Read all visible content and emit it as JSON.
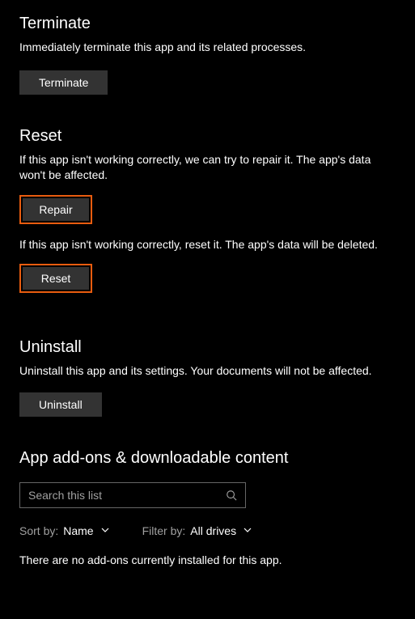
{
  "terminate": {
    "title": "Terminate",
    "desc": "Immediately terminate this app and its related processes.",
    "button": "Terminate"
  },
  "reset": {
    "title": "Reset",
    "repair_desc": "If this app isn't working correctly, we can try to repair it. The app's data won't be affected.",
    "repair_button": "Repair",
    "reset_desc": "If this app isn't working correctly, reset it. The app's data will be deleted.",
    "reset_button": "Reset"
  },
  "uninstall": {
    "title": "Uninstall",
    "desc": "Uninstall this app and its settings. Your documents will not be affected.",
    "button": "Uninstall"
  },
  "addons": {
    "title": "App add-ons & downloadable content",
    "search_placeholder": "Search this list",
    "sort_label": "Sort by:",
    "sort_value": "Name",
    "filter_label": "Filter by:",
    "filter_value": "All drives",
    "empty_msg": "There are no add-ons currently installed for this app."
  }
}
